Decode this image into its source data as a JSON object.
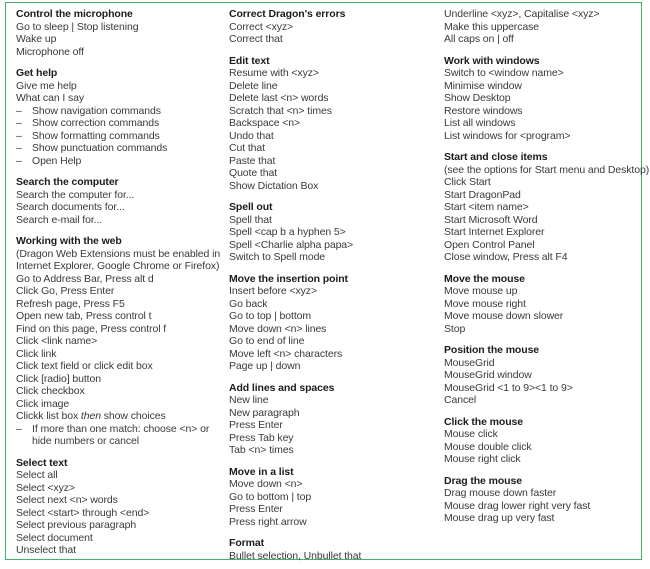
{
  "document": {
    "title": "Dragon command cheat sheet",
    "border_color": "#45b06a",
    "text_color": "#3a3a3a",
    "heading_color": "#1c1c1c"
  },
  "columns": [
    {
      "id": "column-1",
      "blocks": [
        {
          "heading": "Control the microphone",
          "lines": [
            {
              "kind": "plain",
              "text": "Go to sleep | Stop listening"
            },
            {
              "kind": "plain",
              "text": "Wake up"
            },
            {
              "kind": "plain",
              "text": "Microphone off"
            }
          ]
        },
        {
          "heading": "Get help",
          "lines": [
            {
              "kind": "plain",
              "text": "Give me help"
            },
            {
              "kind": "plain",
              "text": "What can I say"
            },
            {
              "kind": "dash",
              "text": "Show navigation commands"
            },
            {
              "kind": "dash",
              "text": "Show correction commands"
            },
            {
              "kind": "dash",
              "text": "Show formatting commands"
            },
            {
              "kind": "dash",
              "text": "Show punctuation commands"
            },
            {
              "kind": "dash",
              "text": "Open Help"
            }
          ]
        },
        {
          "heading": "Search the computer",
          "lines": [
            {
              "kind": "plain",
              "text": "Search the computer for..."
            },
            {
              "kind": "plain",
              "text": "Search documents for..."
            },
            {
              "kind": "plain",
              "text": "Search e-mail for..."
            }
          ]
        },
        {
          "heading": "Working with the web",
          "lines": [
            {
              "kind": "note",
              "text": "(Dragon Web Extensions must be enabled in Internet Explorer, Google Chrome or Firefox)"
            },
            {
              "kind": "plain",
              "text": "Go to Address Bar, Press alt d"
            },
            {
              "kind": "plain",
              "text": "Click Go, Press Enter"
            },
            {
              "kind": "plain",
              "text": "Refresh page, Press F5"
            },
            {
              "kind": "plain",
              "text": "Open new tab, Press control t"
            },
            {
              "kind": "plain",
              "text": "Find on this page, Press control f"
            },
            {
              "kind": "plain",
              "text": "Click <link name>"
            },
            {
              "kind": "plain",
              "text": "Click link"
            },
            {
              "kind": "plain",
              "text": "Click text field or click edit box"
            },
            {
              "kind": "plain",
              "text": "Click [radio] button"
            },
            {
              "kind": "plain",
              "text": "Click checkbox"
            },
            {
              "kind": "plain",
              "text": "Click image"
            },
            {
              "kind": "italic_mid",
              "pre": "Clickk list box ",
              "emphasis": "then",
              "post": " show choices"
            },
            {
              "kind": "dash_wrap",
              "text": "If more than one match: choose <n> or hide numbers or cancel"
            }
          ]
        },
        {
          "heading": "Select text",
          "lines": [
            {
              "kind": "plain",
              "text": "Select all"
            },
            {
              "kind": "plain",
              "text": "Select <xyz>"
            },
            {
              "kind": "plain",
              "text": "Select next <n> words"
            },
            {
              "kind": "plain",
              "text": "Select <start> through <end>"
            },
            {
              "kind": "plain",
              "text": "Select previous paragraph"
            },
            {
              "kind": "plain",
              "text": "Select document"
            },
            {
              "kind": "plain",
              "text": "Unselect that"
            }
          ]
        }
      ]
    },
    {
      "id": "column-2",
      "blocks": [
        {
          "heading": "Correct Dragon's errors",
          "lines": [
            {
              "kind": "plain",
              "text": "Correct <xyz>"
            },
            {
              "kind": "plain",
              "text": "Correct that"
            }
          ]
        },
        {
          "heading": "Edit text",
          "lines": [
            {
              "kind": "plain",
              "text": "Resume with <xyz>"
            },
            {
              "kind": "plain",
              "text": "Delete line"
            },
            {
              "kind": "plain",
              "text": "Delete last <n> words"
            },
            {
              "kind": "plain",
              "text": "Scratch that <n> times"
            },
            {
              "kind": "plain",
              "text": "Backspace <n>"
            },
            {
              "kind": "plain",
              "text": "Undo that"
            },
            {
              "kind": "plain",
              "text": "Cut that"
            },
            {
              "kind": "plain",
              "text": "Paste that"
            },
            {
              "kind": "plain",
              "text": "Quote that"
            },
            {
              "kind": "plain",
              "text": "Show Dictation Box"
            }
          ]
        },
        {
          "heading": "Spell out",
          "lines": [
            {
              "kind": "plain",
              "text": "Spell that"
            },
            {
              "kind": "plain",
              "text": "Spell <cap b a hyphen 5>"
            },
            {
              "kind": "plain",
              "text": "Spell <Charlie alpha papa>"
            },
            {
              "kind": "plain",
              "text": "Switch to Spell mode"
            }
          ]
        },
        {
          "heading": "Move the insertion point",
          "lines": [
            {
              "kind": "plain",
              "text": "Insert before <xyz>"
            },
            {
              "kind": "plain",
              "text": "Go back"
            },
            {
              "kind": "plain",
              "text": "Go to top | bottom"
            },
            {
              "kind": "plain",
              "text": "Move down <n> lines"
            },
            {
              "kind": "plain",
              "text": "Go to end of line"
            },
            {
              "kind": "plain",
              "text": "Move left <n> characters"
            },
            {
              "kind": "plain",
              "text": "Page up | down"
            }
          ]
        },
        {
          "heading": "Add lines and spaces",
          "lines": [
            {
              "kind": "plain",
              "text": "New line"
            },
            {
              "kind": "plain",
              "text": "New paragraph"
            },
            {
              "kind": "plain",
              "text": "Press Enter"
            },
            {
              "kind": "plain",
              "text": "Press Tab key"
            },
            {
              "kind": "plain",
              "text": "Tab <n> times"
            }
          ]
        },
        {
          "heading": "Move in a list",
          "lines": [
            {
              "kind": "plain",
              "text": "Move down <n>"
            },
            {
              "kind": "plain",
              "text": "Go to bottom | top"
            },
            {
              "kind": "plain",
              "text": "Press Enter"
            },
            {
              "kind": "plain",
              "text": "Press right arrow"
            }
          ]
        },
        {
          "heading": "Format",
          "lines": [
            {
              "kind": "plain",
              "text": "Bullet selection, Unbullet that"
            }
          ]
        }
      ]
    },
    {
      "id": "column-3",
      "blocks": [
        {
          "heading": null,
          "lines": [
            {
              "kind": "plain",
              "text": "Underline <xyz>, Capitalise <xyz>"
            },
            {
              "kind": "plain",
              "text": "Make this uppercase"
            },
            {
              "kind": "plain",
              "text": "All caps on | off"
            }
          ]
        },
        {
          "heading": "Work with windows",
          "lines": [
            {
              "kind": "plain",
              "text": "Switch to <window name>"
            },
            {
              "kind": "plain",
              "text": "Minimise window"
            },
            {
              "kind": "plain",
              "text": "Show Desktop"
            },
            {
              "kind": "plain",
              "text": "Restore windows"
            },
            {
              "kind": "plain",
              "text": "List all windows"
            },
            {
              "kind": "plain",
              "text": "List windows for <program>"
            }
          ]
        },
        {
          "heading": "Start and close items",
          "lines": [
            {
              "kind": "plain",
              "text": "(see the options for Start menu and Desktop)"
            },
            {
              "kind": "plain",
              "text": "Click Start"
            },
            {
              "kind": "plain",
              "text": "Start DragonPad"
            },
            {
              "kind": "plain",
              "text": "Start <item name>"
            },
            {
              "kind": "plain",
              "text": "Start Microsoft Word"
            },
            {
              "kind": "plain",
              "text": "Start Internet Explorer"
            },
            {
              "kind": "plain",
              "text": "Open Control Panel"
            },
            {
              "kind": "plain",
              "text": "Close window, Press alt F4"
            }
          ]
        },
        {
          "heading": "Move the mouse",
          "lines": [
            {
              "kind": "plain",
              "text": "Move mouse up"
            },
            {
              "kind": "plain",
              "text": "Move mouse right"
            },
            {
              "kind": "plain",
              "text": "Move mouse down slower"
            },
            {
              "kind": "plain",
              "text": "Stop"
            }
          ]
        },
        {
          "heading": "Position the mouse",
          "lines": [
            {
              "kind": "plain",
              "text": "MouseGrid"
            },
            {
              "kind": "plain",
              "text": "MouseGrid window"
            },
            {
              "kind": "plain",
              "text": "MouseGrid <1 to 9><1 to 9>"
            },
            {
              "kind": "plain",
              "text": "Cancel"
            }
          ]
        },
        {
          "heading": "Click the mouse",
          "lines": [
            {
              "kind": "plain",
              "text": "Mouse click"
            },
            {
              "kind": "plain",
              "text": "Mouse double click"
            },
            {
              "kind": "plain",
              "text": "Mouse right click"
            }
          ]
        },
        {
          "heading": "Drag the mouse",
          "lines": [
            {
              "kind": "plain",
              "text": "Drag mouse down faster"
            },
            {
              "kind": "plain",
              "text": "Mouse drag lower right very fast"
            },
            {
              "kind": "plain",
              "text": "Mouse drag up very fast"
            }
          ]
        }
      ]
    }
  ]
}
